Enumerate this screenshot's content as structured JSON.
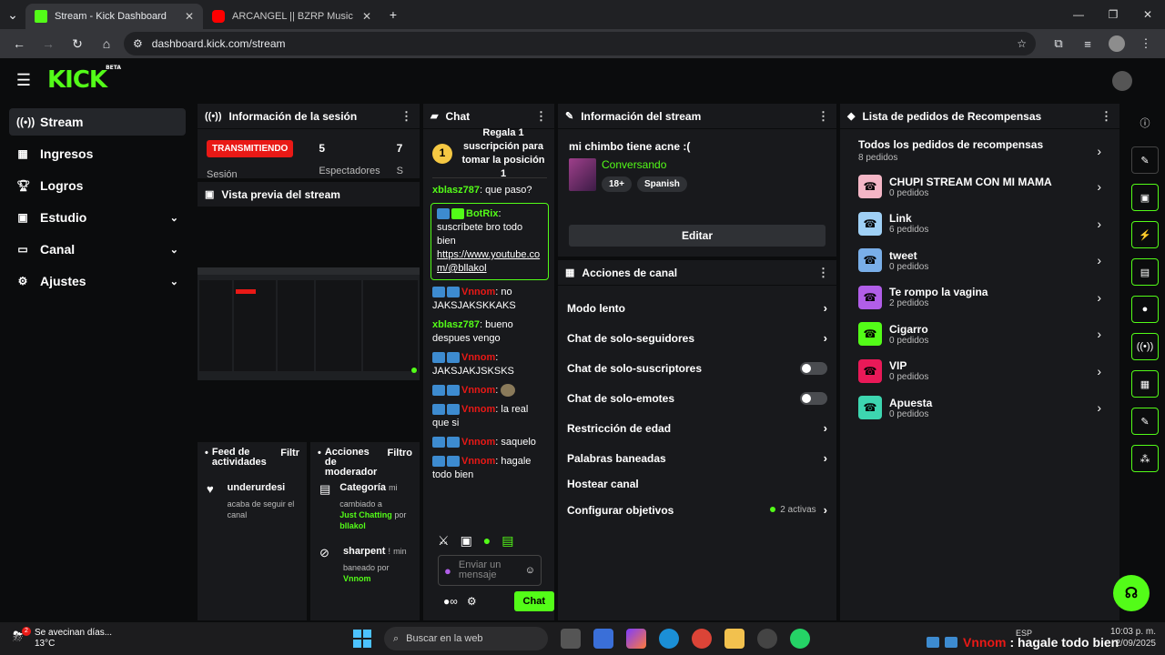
{
  "browser": {
    "tabs": [
      {
        "title": "Stream - Kick Dashboard",
        "active": true
      },
      {
        "title": "ARCANGEL || BZRP Music Sessi",
        "active": false
      }
    ],
    "url": "dashboard.kick.com/stream"
  },
  "header": {
    "logo": "KICK",
    "beta": "BETA"
  },
  "sidebar": {
    "items": [
      {
        "label": "Stream",
        "icon": "stream-icon"
      },
      {
        "label": "Ingresos",
        "icon": "income-icon"
      },
      {
        "label": "Logros",
        "icon": "trophy-icon"
      },
      {
        "label": "Estudio",
        "icon": "studio-icon"
      },
      {
        "label": "Canal",
        "icon": "channel-icon"
      },
      {
        "label": "Ajustes",
        "icon": "gear-icon"
      }
    ]
  },
  "session": {
    "title": "Información de la sesión",
    "status": "TRANSMITIENDO",
    "label": "Sesión",
    "viewers": "5",
    "viewers_label": "Espectadores",
    "cut_number": "7",
    "cut_label": "S"
  },
  "preview": {
    "title": "Vista previa del stream"
  },
  "feed": {
    "title": "Feed de actividades",
    "filter": "Filtr",
    "items": [
      {
        "user": "underurdesi",
        "text": "acaba de seguir el canal"
      }
    ]
  },
  "modactions": {
    "title": "Acciones de moderador",
    "filter": "Filtro",
    "items": [
      {
        "title": "Categoría",
        "time": "mi",
        "line1": "cambiado a",
        "highlight": "Just Chatting",
        "line2": "por",
        "by": "bllakol"
      },
      {
        "title": "sharpent",
        "time": "min",
        "line1": "baneado por",
        "by": "Vnnom",
        "mark": "!"
      }
    ]
  },
  "chat": {
    "title": "Chat",
    "pinned": {
      "coin": "1",
      "text": "Regala 1 suscripción para tomar la posición 1"
    },
    "messages": [
      {
        "user": "xblasz787",
        "text": ": que paso?",
        "kind": "green"
      },
      {
        "user": "BotRix",
        "text": ": suscríbete bro todo bien ",
        "link": "https://www.youtube.com/@bllakol",
        "kind": "bot"
      },
      {
        "user": "Vnnom",
        "text": ": no JAKSJAKSKKAKS",
        "kind": "red"
      },
      {
        "user": "xblasz787",
        "text": ": bueno despues vengo",
        "kind": "green"
      },
      {
        "user": "Vnnom",
        "text": ": JAKSJAKJSKSKS",
        "kind": "red"
      },
      {
        "user": "Vnnom",
        "text": ":",
        "kind": "red"
      },
      {
        "user": "Vnnom",
        "text": ": la real que si",
        "kind": "red"
      },
      {
        "user": "Vnnom",
        "text": ": saquelo",
        "kind": "red"
      },
      {
        "user": "Vnnom",
        "text": ": hagale todo bien",
        "kind": "red"
      }
    ],
    "input_placeholder": "Enviar un mensaje",
    "send_label": "Chat"
  },
  "stream_info": {
    "title": "Información del stream",
    "stream_title": "mi chimbo tiene acne :(",
    "category": "Conversando",
    "tags": [
      "18+",
      "Spanish"
    ],
    "edit_label": "Editar"
  },
  "channel_actions": {
    "title": "Acciones de canal",
    "rows": [
      {
        "label": "Modo lento",
        "control": "arrow"
      },
      {
        "label": "Chat de solo-seguidores",
        "control": "arrow"
      },
      {
        "label": "Chat de solo-suscriptores",
        "control": "toggle"
      },
      {
        "label": "Chat de solo-emotes",
        "control": "toggle"
      },
      {
        "label": "Restricción de edad",
        "control": "arrow"
      },
      {
        "label": "Palabras baneadas",
        "control": "arrow"
      },
      {
        "label": "Hostear canal",
        "control": "none"
      },
      {
        "label": "Configurar objetivos",
        "control": "arrow",
        "extra": "2 activas"
      }
    ]
  },
  "rewards": {
    "title": "Lista de pedidos de Recompensas",
    "all": {
      "title": "Todos los pedidos de recompensas",
      "count": "8 pedidos"
    },
    "items": [
      {
        "title": "CHUPI STREAM CON MI MAMA",
        "count": "0 pedidos",
        "color": "#f4b6c6"
      },
      {
        "title": "Link",
        "count": "6 pedidos",
        "color": "#9fd0f5"
      },
      {
        "title": "tweet",
        "count": "0 pedidos",
        "color": "#79aee8"
      },
      {
        "title": "Te rompo la vagina",
        "count": "2 pedidos",
        "color": "#b15ee8"
      },
      {
        "title": "Cigarro",
        "count": "0 pedidos",
        "color": "#53fc18"
      },
      {
        "title": "VIP",
        "count": "0 pedidos",
        "color": "#e91958"
      },
      {
        "title": "Apuesta",
        "count": "0 pedidos",
        "color": "#3dd6b0"
      }
    ]
  },
  "taskbar": {
    "weather_title": "Se avecinan días...",
    "weather_temp": "13°C",
    "weather_badge": "2",
    "search_placeholder": "Buscar en la web",
    "overlay_user": "Vnnom",
    "overlay_text": ": hagale todo bien",
    "lang": "ESP",
    "time": "10:03 p. m.",
    "date": "2/09/2025"
  }
}
